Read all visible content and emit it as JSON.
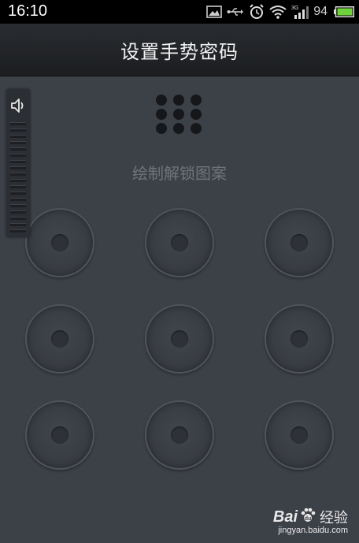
{
  "status_bar": {
    "time": "16:10",
    "battery_percent": "94",
    "icons": [
      "image-icon",
      "usb-icon",
      "alarm-icon",
      "wifi-icon",
      "signal-3g-icon",
      "battery-icon"
    ],
    "network_label": "3G"
  },
  "header": {
    "title": "设置手势密码"
  },
  "main": {
    "hint": "绘制解锁图案",
    "pattern_nodes": 9
  },
  "volume_overlay": {
    "icon": "speaker-icon",
    "level": 0
  },
  "watermark": {
    "brand_left": "Bai",
    "brand_right": "经验",
    "url": "jingyan.baidu.com"
  },
  "colors": {
    "background": "#3c4047",
    "titlebar": "#1f2226",
    "hint_text": "#6f747b"
  }
}
